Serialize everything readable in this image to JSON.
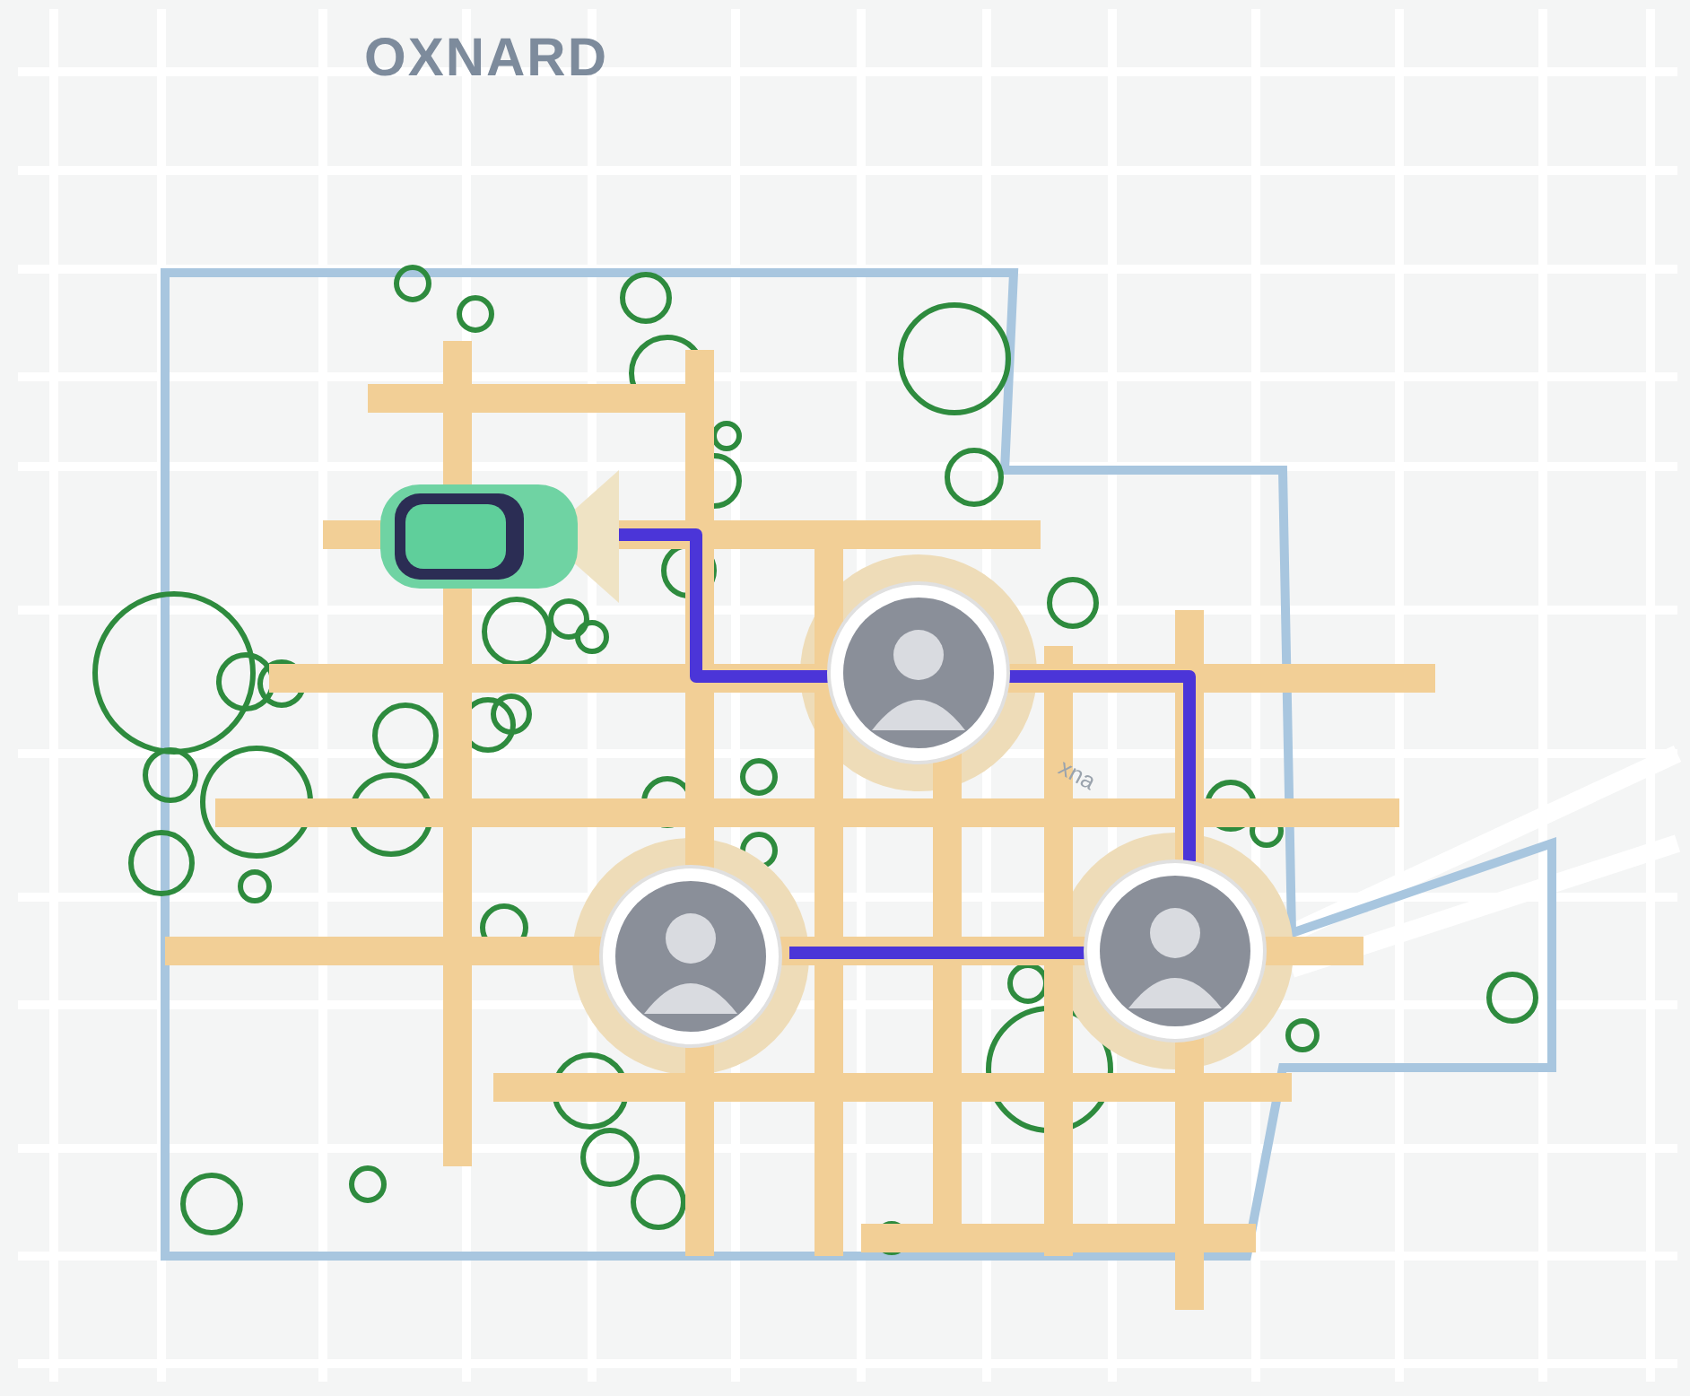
{
  "map": {
    "city_label": "OXNARD",
    "street_label": "xna"
  }
}
